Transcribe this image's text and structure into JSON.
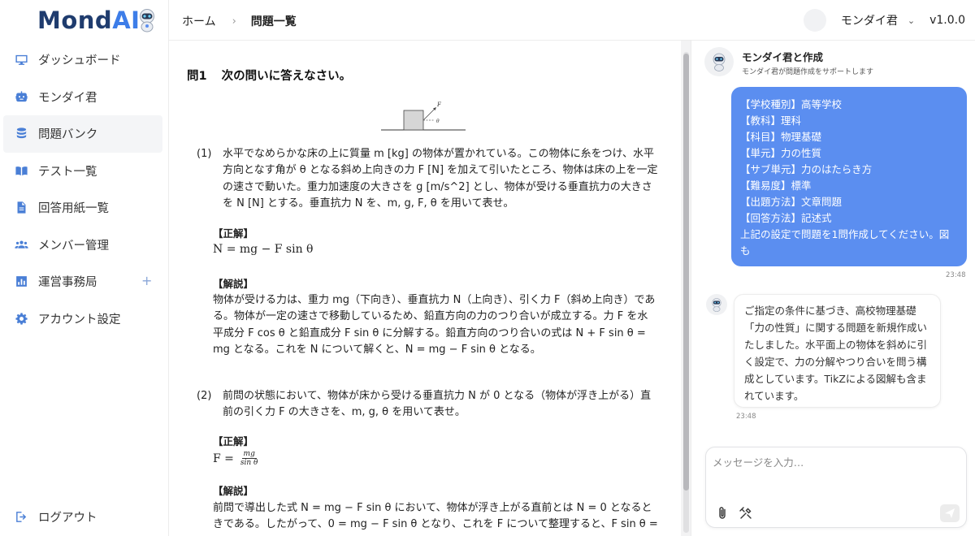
{
  "app": {
    "logo_main": "Mond",
    "logo_accent": "AI"
  },
  "sidebar": {
    "items": [
      {
        "label": "ダッシュボード",
        "icon": "monitor-icon"
      },
      {
        "label": "モンダイ君",
        "icon": "robot-icon"
      },
      {
        "label": "問題バンク",
        "icon": "database-icon",
        "active": true
      },
      {
        "label": "テスト一覧",
        "icon": "book-icon"
      },
      {
        "label": "回答用紙一覧",
        "icon": "document-icon"
      },
      {
        "label": "メンバー管理",
        "icon": "people-icon"
      },
      {
        "label": "運営事務局",
        "icon": "chart-icon",
        "expand": "+"
      },
      {
        "label": "アカウント設定",
        "icon": "gear-icon"
      }
    ],
    "logout": "ログアウト"
  },
  "header": {
    "breadcrumb": [
      "ホーム",
      "問題一覧"
    ],
    "breadcrumb_sep": "›",
    "user_name": "モンダイ君",
    "version": "v1.0.0"
  },
  "document": {
    "question_number": "問1",
    "question_title": "次の問いに答えなさい。",
    "figure_labels": {
      "force": "F",
      "angle": "θ"
    },
    "parts": [
      {
        "number": "(1)",
        "text": "水平でなめらかな床の上に質量 m [kg] の物体が置かれている。この物体に糸をつけ、水平方向となす角が θ となる斜め上向きの力 F [N] を加えて引いたところ、物体は床の上を一定の速さで動いた。重力加速度の大きさを g [m/s^2] とし、物体が受ける垂直抗力の大きさを N [N] とする。垂直抗力 N を、m, g, F, θ を用いて表せ。",
        "answer_label": "【正解】",
        "answer": "N = mg − F sin θ",
        "explanation_label": "【解説】",
        "explanation": "物体が受ける力は、重力 mg（下向き）、垂直抗力 N（上向き）、引く力 F（斜め上向き）である。物体が一定の速さで移動しているため、鉛直方向の力のつり合いが成立する。力 F を水平成分 F cos θ と鉛直成分 F sin θ に分解する。鉛直方向のつり合いの式は N + F sin θ = mg となる。これを N について解くと、N = mg − F sin θ となる。"
      },
      {
        "number": "(2)",
        "text": "前問の状態において、物体が床から受ける垂直抗力 N が 0 となる（物体が浮き上がる）直前の引く力 F の大きさを、m, g, θ を用いて表せ。",
        "answer_label": "【正解】",
        "answer_lhs": "F =",
        "answer_num": "mg",
        "answer_den": "sin θ",
        "explanation_label": "【解説】",
        "explanation": "前問で導出した式 N = mg − F sin θ において、物体が浮き上がる直前とは N = 0 となるときである。したがって、0 = mg − F sin θ となり、これを F について整理すると、F sin θ ="
      }
    ]
  },
  "chat": {
    "title": "モンダイ君と作成",
    "subtitle": "モンダイ君が問題作成をサポートします",
    "user_message_lines": [
      "【学校種別】高等学校",
      "【教科】理科",
      "【科目】物理基礎",
      "【単元】力の性質",
      "【サブ単元】力のはたらき方",
      "【難易度】標準",
      "【出題方法】文章問題",
      "【回答方法】記述式",
      "上記の設定で問題を1問作成してください。図も"
    ],
    "user_time": "23:48",
    "bot_message": "ご指定の条件に基づき、高校物理基礎「力の性質」に関する問題を新規作成いたしました。水平面上の物体を斜めに引く設定で、力の分解やつり合いを問う構成としています。TikZによる図解も含まれています。",
    "bot_time": "23:48",
    "input_placeholder": "メッセージを入力…"
  },
  "colors": {
    "accent": "#4a7fd6",
    "user_bubble": "#5b8ef0",
    "logo_dark": "#1f3c6e",
    "logo_accent": "#3d7de8"
  }
}
